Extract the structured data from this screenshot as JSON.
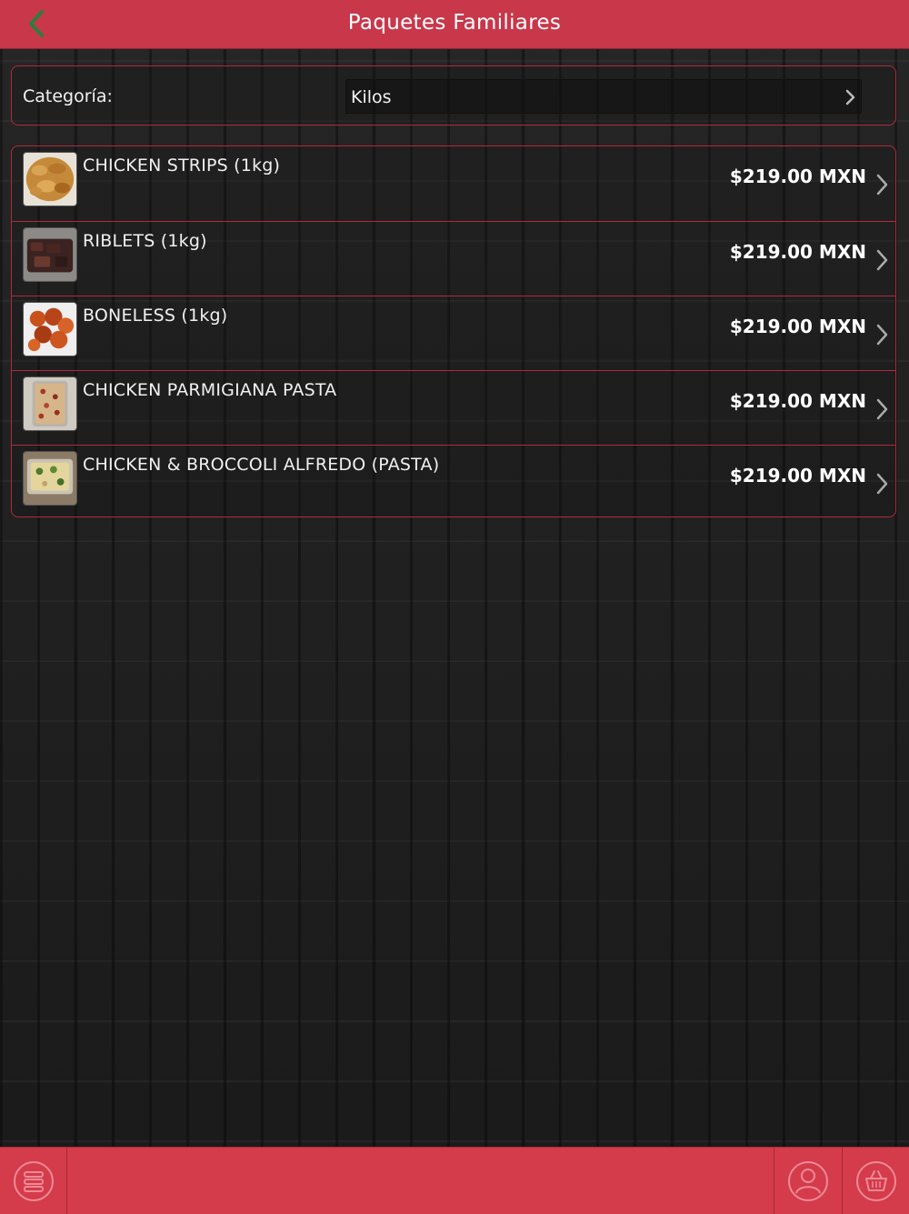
{
  "header": {
    "title": "Paquetes Familiares",
    "back_icon": "chevron-left-icon",
    "back_color": "#2e7d3e"
  },
  "category": {
    "label": "Categoría:",
    "selected": "Kilos"
  },
  "products": [
    {
      "name": "CHICKEN STRIPS (1kg)",
      "price": "$219.00 MXN",
      "thumb": "chicken-strips-thumbnail"
    },
    {
      "name": "RIBLETS (1kg)",
      "price": "$219.00 MXN",
      "thumb": "riblets-thumbnail"
    },
    {
      "name": "BONELESS (1kg)",
      "price": "$219.00 MXN",
      "thumb": "boneless-thumbnail"
    },
    {
      "name": "CHICKEN PARMIGIANA PASTA",
      "price": "$219.00 MXN",
      "thumb": "parmigiana-pasta-thumbnail"
    },
    {
      "name": "CHICKEN & BROCCOLI ALFREDO (PASTA)",
      "price": "$219.00 MXN",
      "thumb": "alfredo-pasta-thumbnail"
    }
  ],
  "bottombar": {
    "menu_icon": "menu-stack-icon",
    "user_icon": "user-icon",
    "cart_icon": "basket-icon"
  },
  "colors": {
    "accent": "#c8374a",
    "border": "#b02a3c",
    "bottombar": "#d43b4b"
  }
}
